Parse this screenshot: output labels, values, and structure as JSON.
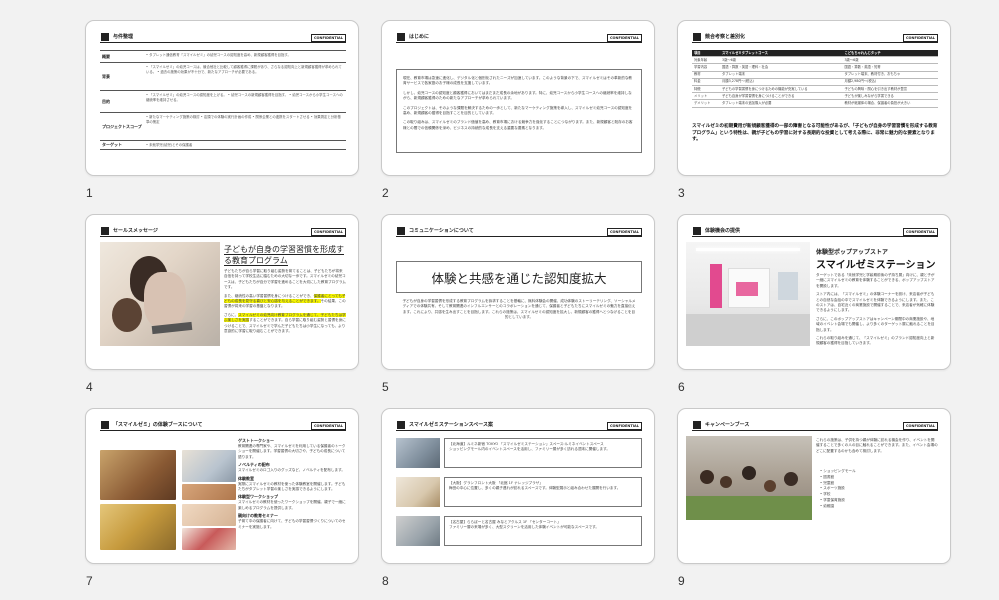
{
  "confidential": "CONFIDENTIAL",
  "slides": [
    {
      "num": "1",
      "title": "与件整理",
      "rows": [
        {
          "key": "概要",
          "value": "• タブレット通信教育「スマイルゼミ」の幼児コースの認知度を高め、新規顧客獲得を目指す。"
        },
        {
          "key": "背景",
          "value": "• 「スマイルゼミ」の幼児コースは、競合他社と比較して顧客獲得に課題があり、さらなる認知向上と新規顧客獲得が求められている。 • 過去の施策の効果が不十分で、新たなアプローチが必要である。"
        },
        {
          "key": "目的",
          "value": "• 「スマイルゼミ」の幼児コースの認知度を上げる。 • 幼児コースの新規顧客獲得を目指す。 • 幼児コースから小学生コースへの継続率を維持させる。"
        },
        {
          "key": "プロジェクトスコープ",
          "value": "• 新たなマーケティング施策の検討 • 店頭での体験の実行計画の作成 • 関係企業との連携をスタートさせる • 効果測定と分析基準の策定"
        },
        {
          "key": "ターゲット",
          "value": "• 未就学児(幼児)とその保護者"
        }
      ]
    },
    {
      "num": "2",
      "title": "はじめに",
      "paragraphs": [
        "現在、教育市場は急速に進化し、デジタル化と個別化されたニーズが加速しています。このような背景の下で、スマイルゼミはその革新的な教育サービスで各家庭のお子様の成長を支援しています。",
        "しかし、幼児コースの認知度と顧客獲得においてはまだまだ成長の余地があります。特に、幼児コースから小学生コースへの継続率を維持しながら、新規顧客獲得のための新たなアプローチが求められています。",
        "このプロジェクトは、そのような課題を解決するための一歩として、新たなマーケティング施策を導入し、スマイルゼミ幼児コースの認知度を高め、新規顧客の獲得を目指すことを目的としています。",
        "この取り組みは、スマイルゼミのブランド価値を高め、教育市場における競争力を強化することにつながります。また、新規顧客と既存のお客様との間での信頼関係を深め、ビジネスの持続的な成長を支える重要な要素となります。"
      ]
    },
    {
      "num": "3",
      "title": "競合考察と差別化",
      "headers": [
        "項目",
        "スマイルゼミタブレットコース",
        "こどもちゃれんじタッチ"
      ],
      "rows": [
        [
          "対象年齢",
          "3歳〜6歳",
          "3歳〜6歳"
        ],
        [
          "学習内容",
          "国語・算数・英語・理科・社会",
          "国語・算数・英語・知育"
        ],
        [
          "教材",
          "タブレット端末",
          "タブレット端末、教材付き、おもちゃ"
        ],
        [
          "料金",
          "月額3,278円〜(税込)",
          "月額2,980円〜(税込)"
        ],
        [
          "特徴",
          "子どもの学習習慣を身につけるための機能が充実している",
          "子どもの興味・関心を引き出す教材が豊富"
        ],
        [
          "メリット",
          "子ども自身が学習習慣を身につけることができる",
          "子どもが楽しみながら学習できる"
        ],
        [
          "デメリット",
          "タブレット端末の追加購入が必要",
          "教材が紙媒体の場合、保護者の負担が大きい"
        ]
      ],
      "summary": "スマイルゼミの初期費用が新規顧客獲得の一部の障害となる可能性があるが、「子どもが自身の学習習慣を形成する教育プログラム」という特性は、親が子どもの学習に対する長期的な投資として考える際に、非常に魅力的な要素となります。"
    },
    {
      "num": "4",
      "title": "セールスメッセージ",
      "headline": "子どもが自身の学習習慣を形成する教育プログラム",
      "p1": "子どもたちが自ら学習に取り組む姿勢を育てることは、子どもたちが将来自信を持って学校生活に臨むための大切な一歩です。スマイルゼミの幼児コースは、子どもたちが自分で学習を進めることを大切にした教育プログラムです。",
      "p2a": "また、継続性の高い学習習慣を身につけることができ、",
      "p2hl": "保護者にとっても子どもの成長を見守る喜びと安心感を与えることができます。",
      "p2b": "その結果、この習慣が将来の学習の基盤となります。",
      "p3a": "さらに、",
      "p3hl": "スマイルゼミの幼児向け教育プログラムを通じて、子どもたちは学ぶ楽しさを実感",
      "p3b": "することができます。自ら学習に取り組む姿勢と習慣を身につけることで、スマイルゼミで学んだ子どもたちは小学生になっても、より意欲的に学習に取り組むことができます。"
    },
    {
      "num": "5",
      "title": "コミュニケーションについて",
      "headline": "体験と共感を通じた認知度拡大",
      "body": "子どもが自身の学習習慣を形成する教育プログラムを訴求することを基軸に、無料体験会の開催、成功体験のストーリーテリング、ソーシャルメディアでの体験共有、そして教育関連のインフルエンサーとのコラボレーションを通じて、保護者と子どもたちにスマイルゼミの魅力を直接伝えます。これにより、共感を生み出すことを目指します。これらの施策は、スマイルゼミの認知度を拡大し、新規顧客の獲得へとつなげることを目的としています。"
    },
    {
      "num": "6",
      "title": "体験機会の提供",
      "subtitle": "体験型ポップアップストア",
      "headline": "スマイルゼミステーション",
      "p1": "ターゲットである「未就学児と学齢期前後の子持ち層」向けに、親と子が一緒にスマイルゼミの教育を体験することができる、ポップアップストアを開設します。",
      "p2": "ストア内には、「スマイルゼミ」の体験コーナーを設け、来店者が子どもとの自然な会話の中でスマイルゼミを体験できるようにします。また、このストアは、自宅近くの商業施設で開催することで、来店者が気軽に体験できるようにします。",
      "p3": "さらに、このポップアップストアはキャンペーン期間中の商業施設や、地域のイベント会場でも開催し、より多くのターゲット層に触れることを目指します。",
      "p4": "これらの取り組みを通じて、「スマイルゼミ」のブランド認知度向上と新規顧客の獲得を目指していきます。"
    },
    {
      "num": "7",
      "title": "「スマイルゼミ」の体験ブースについて",
      "items": [
        {
          "h": "ゲストトークショー",
          "b": "教育関連の専門家や、スマイルゼミを利用している保護者のトークショーを開催します。学習習慣の大切さや、子どもの成長について語ります。"
        },
        {
          "h": "ノベルティの配布",
          "b": "スマイルゼミのロゴ入りのグッズなど、ノベルティを配布します。"
        },
        {
          "h": "体験教室",
          "b": "実際にスマイルゼミの教材を使った体験教室を開催します。子どもたちがタブレット学習の楽しさを実感できるようにします。"
        },
        {
          "h": "体験型ワークショップ",
          "b": "スマイルゼミの教材を使ったワークショップを開催。親子で一緒に楽しめるプログラムを提供します。"
        },
        {
          "h": "親向けの教育セミナー",
          "b": "子育て中の保護者に向けて、子どもの学習習慣づくりについてのセミナーを実施します。"
        }
      ]
    },
    {
      "num": "8",
      "title": "スマイルゼミステーションスペース案",
      "rows": [
        {
          "t": "【北海道】ルミネ新宿 TOKYO 「スマイルゼミステーション」スペース:ルミネイベントスペース",
          "b": "ショッピングモール内のイベントスペースを活用し、ファミリー層が多く訪れる週末に開催します。"
        },
        {
          "t": "【大阪】グランフロント大阪 「北館 1F ナレッジプラザ」",
          "b": "梅田の中心に位置し、多くの親子連れが訪れるスペースです。体験型展示と組み合わせた展開を行います。"
        },
        {
          "t": "【名古屋】ららぽーと名古屋 みなとアクルス 1F 「センターコート」",
          "b": "ファミリー層の来場が多く、大型スクリーンを活用した体験イベントが可能なスペースです。"
        }
      ]
    },
    {
      "num": "9",
      "title": "キャンペーンブース",
      "body": "これらの施策は、子供を持つ親が体験に訪れる機会を作り、イベントを開催することで多くの人の目に触れることができます。また、イベント会場のどこに配置するのかも含めて検討します。",
      "list": [
        "ショッピングモール",
        "図書館",
        "児童館",
        "スポーツ施設",
        "学校",
        "学童保育施設",
        "幼稚園"
      ]
    }
  ]
}
